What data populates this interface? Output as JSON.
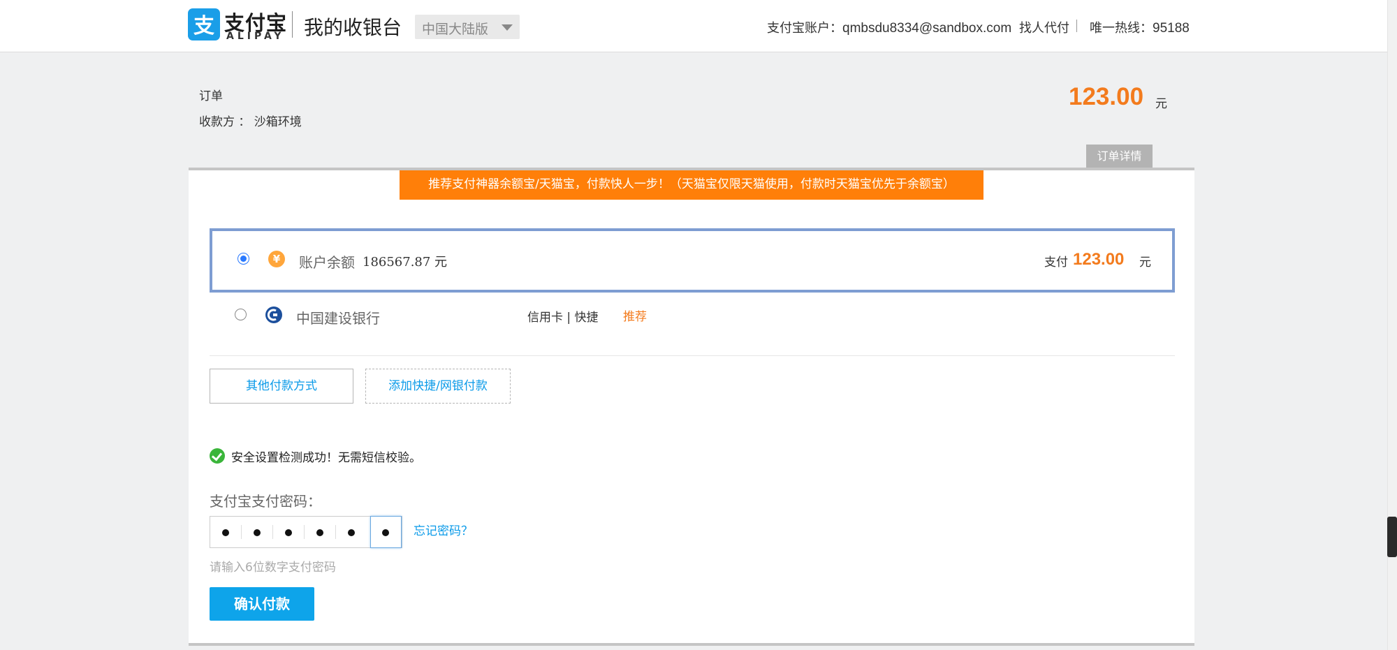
{
  "header": {
    "logo_text": "支付宝",
    "logo_sub": "ALIPAY",
    "title": "我的收银台",
    "region": "中国大陆版",
    "account_label": "支付宝账户：",
    "account_email": "qmbsdu8334@sandbox.com",
    "find_payer": "找人代付",
    "hotline_label": "唯一热线：",
    "hotline_number": "95188"
  },
  "order": {
    "label": "订单",
    "payee": "收款方 ： 沙箱环境",
    "amount": "123.00",
    "unit": "元",
    "detail_button": "订单详情"
  },
  "promo": "推荐支付神器余额宝/天猫宝，付款快人一步！（天猫宝仅限天猫使用，付款时天猫宝优先于余额宝）",
  "methods": [
    {
      "name": "账户余额",
      "balance": "186567.87 元",
      "icon": "yuan-icon",
      "selected": true,
      "pay_label": "支付",
      "pay_amount": "123.00",
      "pay_unit": "元"
    },
    {
      "name": "中国建设银行",
      "icon": "ccb-bank-icon",
      "selected": false,
      "card_type": "信用卡 | 快捷",
      "badge": "推荐"
    }
  ],
  "buttons": {
    "other_methods": "其他付款方式",
    "add_method": "添加快捷/网银付款",
    "confirm": "确认付款"
  },
  "security": {
    "message": "安全设置检测成功！无需短信校验。"
  },
  "password": {
    "label": "支付宝支付密码：",
    "digits_filled": 6,
    "forgot": "忘记密码？",
    "hint": "请输入6位数字支付密码"
  },
  "colors": {
    "accent_orange": "#f37b1d",
    "link_blue": "#0a9ae8",
    "brand_blue": "#1a9ee8",
    "selected_border": "#7e9dd2"
  }
}
